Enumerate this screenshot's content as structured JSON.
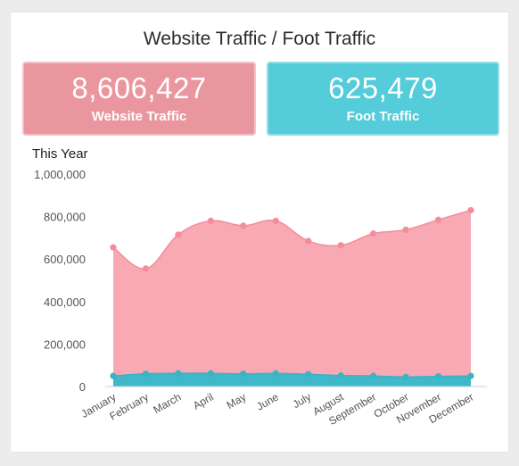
{
  "dashboard": {
    "title": "Website Traffic / Foot Traffic"
  },
  "kpis": {
    "website": {
      "value": "8,606,427",
      "label": "Website Traffic",
      "color": "#ea969f"
    },
    "foot": {
      "value": "625,479",
      "label": "Foot Traffic",
      "color": "#54ccd9"
    }
  },
  "chart_data": {
    "type": "area",
    "title": "This Year",
    "categories": [
      "January",
      "February",
      "March",
      "April",
      "May",
      "June",
      "July",
      "August",
      "September",
      "October",
      "November",
      "December"
    ],
    "ylim": [
      0,
      1000000
    ],
    "yticks": [
      "0",
      "200,000",
      "400,000",
      "600,000",
      "800,000",
      "1,000,000"
    ],
    "grid": false,
    "series": [
      {
        "color": "#f8a9b4",
        "point_color": "#f38d9b",
        "values": [
          655000,
          555000,
          715000,
          780000,
          757000,
          780000,
          685000,
          665000,
          720000,
          738000,
          785000,
          830000
        ]
      },
      {
        "color": "#3fb8c9",
        "point_color": "#3ab3c4",
        "values": [
          50000,
          60000,
          62000,
          62000,
          60000,
          62000,
          58000,
          52000,
          50000,
          45000,
          48000,
          50000
        ]
      }
    ]
  }
}
